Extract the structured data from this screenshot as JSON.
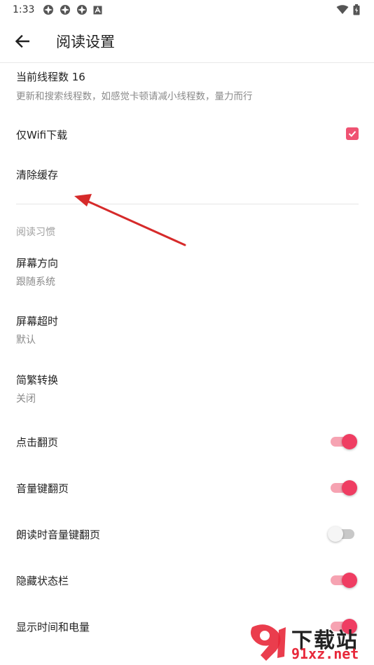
{
  "status_bar": {
    "time": "1:33",
    "icons": [
      "app-notification-icon",
      "app-notification-icon",
      "app-notification-icon",
      "a-icon"
    ],
    "right_icons": [
      "wifi-icon",
      "battery-icon"
    ]
  },
  "app_bar": {
    "title": "阅读设置"
  },
  "settings": {
    "thread_count": {
      "title": "当前线程数 16",
      "subtitle": "更新和搜索线程数，如感觉卡顿请减小线程数，量力而行"
    },
    "wifi_only": {
      "title": "仅Wifi下载",
      "checked": true
    },
    "clear_cache": {
      "title": "清除缓存"
    },
    "section_reading": "阅读习惯",
    "screen_orientation": {
      "title": "屏幕方向",
      "subtitle": "跟随系统"
    },
    "screen_timeout": {
      "title": "屏幕超时",
      "subtitle": "默认"
    },
    "chinese_convert": {
      "title": "简繁转换",
      "subtitle": "关闭"
    },
    "tap_turn": {
      "title": "点击翻页",
      "on": true
    },
    "volume_turn": {
      "title": "音量键翻页",
      "on": true
    },
    "tts_volume_turn": {
      "title": "朗读时音量键翻页",
      "on": false
    },
    "hide_status_bar": {
      "title": "隐藏状态栏",
      "on": true
    },
    "show_time_battery": {
      "title": "显示时间和电量",
      "on": true
    }
  },
  "colors": {
    "accent": "#ef3d62",
    "arrow": "#d62a2a"
  },
  "watermark": {
    "top": "下载站",
    "bottom": "91xz.net"
  }
}
